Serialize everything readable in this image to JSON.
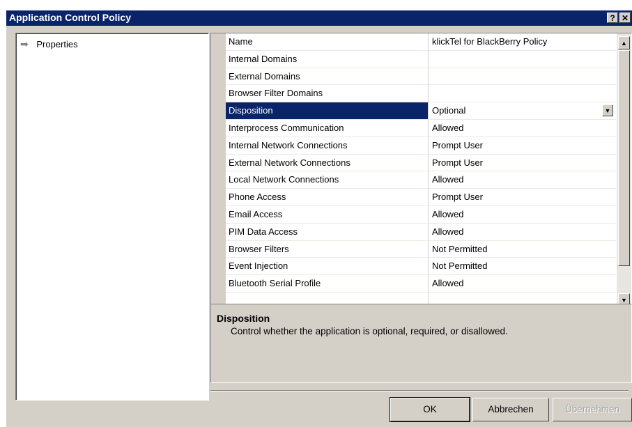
{
  "window": {
    "title": "Application Control Policy",
    "help_glyph": "?",
    "close_glyph": "✕"
  },
  "tree": {
    "items": [
      {
        "label": "Properties",
        "icon": "arrow-right-icon"
      }
    ]
  },
  "properties": [
    {
      "name": "Name",
      "value": "klickTel for BlackBerry Policy"
    },
    {
      "name": "Internal Domains",
      "value": ""
    },
    {
      "name": "External Domains",
      "value": ""
    },
    {
      "name": "Browser Filter Domains",
      "value": ""
    },
    {
      "name": "Disposition",
      "value": "Optional",
      "selected": true
    },
    {
      "name": "Interprocess Communication",
      "value": "Allowed"
    },
    {
      "name": "Internal Network Connections",
      "value": "Prompt User"
    },
    {
      "name": "External Network Connections",
      "value": "Prompt User"
    },
    {
      "name": "Local Network Connections",
      "value": "Allowed"
    },
    {
      "name": "Phone Access",
      "value": "Prompt User"
    },
    {
      "name": "Email Access",
      "value": "Allowed"
    },
    {
      "name": "PIM Data Access",
      "value": "Allowed"
    },
    {
      "name": "Browser Filters",
      "value": "Not Permitted"
    },
    {
      "name": "Event Injection",
      "value": "Not Permitted"
    },
    {
      "name": "Bluetooth Serial Profile",
      "value": "Allowed"
    },
    {
      "name": "",
      "value": ""
    }
  ],
  "description": {
    "title": "Disposition",
    "text": "Control whether the application is optional, required, or disallowed."
  },
  "buttons": {
    "ok": "OK",
    "cancel": "Abbrechen",
    "apply": "Übernehmen"
  },
  "colors": {
    "titlebar": "#0a246a",
    "selection": "#0a246a",
    "face": "#d4d0c8"
  }
}
